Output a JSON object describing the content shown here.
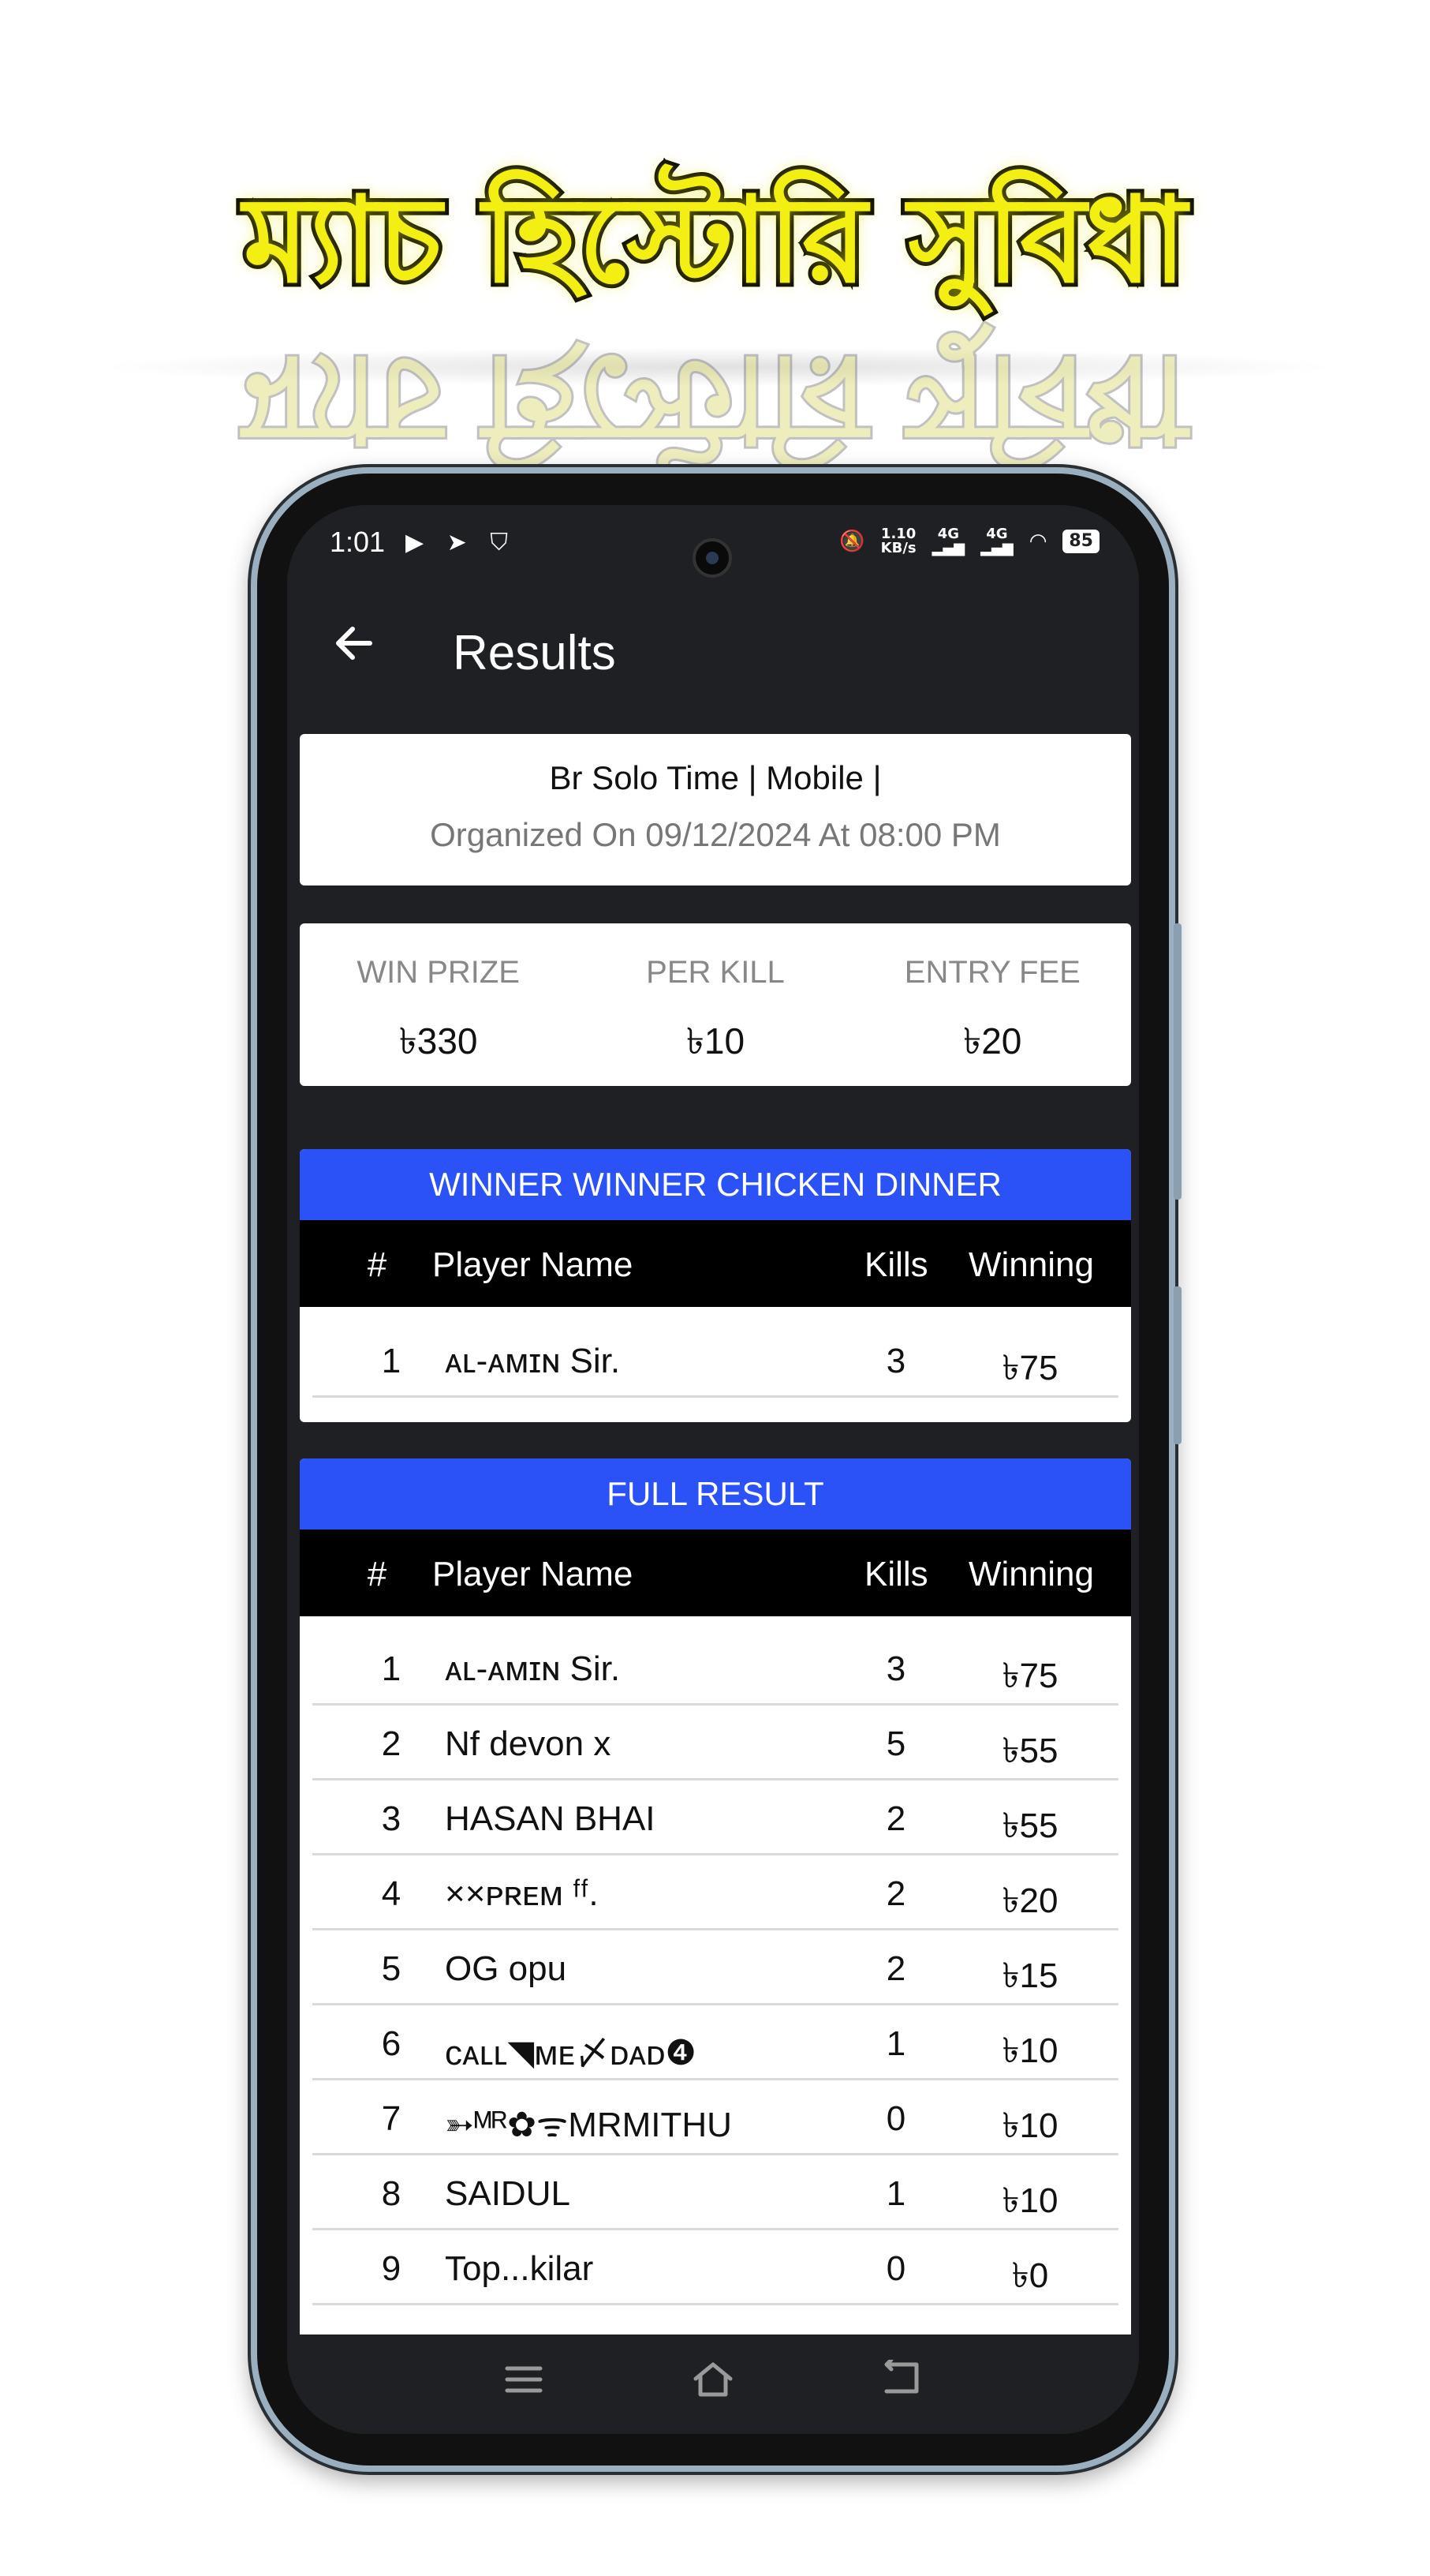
{
  "banner": {
    "title": "ম্যাচ হিস্টোরি সুবিধা"
  },
  "status_bar": {
    "time": "1:01",
    "left_icons": [
      "play-icon",
      "telegram-icon",
      "shield-icon"
    ],
    "net_speed_value": "1.10",
    "net_speed_unit": "KB/s",
    "signal1": "4G",
    "signal2": "4G",
    "battery": "85"
  },
  "appbar": {
    "title": "Results"
  },
  "match": {
    "name": "Br Solo Time | Mobile |",
    "organized": "Organized On 09/12/2024 At 08:00 PM"
  },
  "prizes": {
    "win_prize_label": "WIN PRIZE",
    "win_prize_value": "৳330",
    "per_kill_label": "PER KILL",
    "per_kill_value": "৳10",
    "entry_fee_label": "ENTRY FEE",
    "entry_fee_value": "৳20"
  },
  "columns": {
    "num": "#",
    "player": "Player Name",
    "kills": "Kills",
    "winning": "Winning"
  },
  "winner_section": {
    "title": "WINNER WINNER CHICKEN DINNER",
    "rows": [
      {
        "num": "1",
        "name": "ᴀʟ-ᴀᴍɪɴ  Sir.",
        "kills": "3",
        "winning": "৳75"
      }
    ]
  },
  "full_section": {
    "title": "FULL RESULT",
    "rows": [
      {
        "num": "1",
        "name": "ᴀʟ-ᴀᴍɪɴ  Sir.",
        "kills": "3",
        "winning": "৳75"
      },
      {
        "num": "2",
        "name": "Nf devon x",
        "kills": "5",
        "winning": "৳55"
      },
      {
        "num": "3",
        "name": "HASAN BHAI",
        "kills": "2",
        "winning": "৳55"
      },
      {
        "num": "4",
        "name": "××ᴘʀᴇᴍ  ᶠᶠ.",
        "kills": "2",
        "winning": "৳20"
      },
      {
        "num": "5",
        "name": "OG opu",
        "kills": "2",
        "winning": "৳15"
      },
      {
        "num": "6",
        "name": "ᴄᴀʟʟ◥ᴍᴇ〆ᴅᴀᴅ❹",
        "kills": "1",
        "winning": "৳10"
      },
      {
        "num": "7",
        "name": "➳ᴹᴿ✿ᯤMRMITHU",
        "kills": "0",
        "winning": "৳10"
      },
      {
        "num": "8",
        "name": "SAIDUL",
        "kills": "1",
        "winning": "৳10"
      },
      {
        "num": "9",
        "name": "Top...kilar",
        "kills": "0",
        "winning": "৳0"
      }
    ]
  },
  "navbar": {
    "icons": [
      "menu-icon",
      "home-icon",
      "back-icon"
    ]
  }
}
